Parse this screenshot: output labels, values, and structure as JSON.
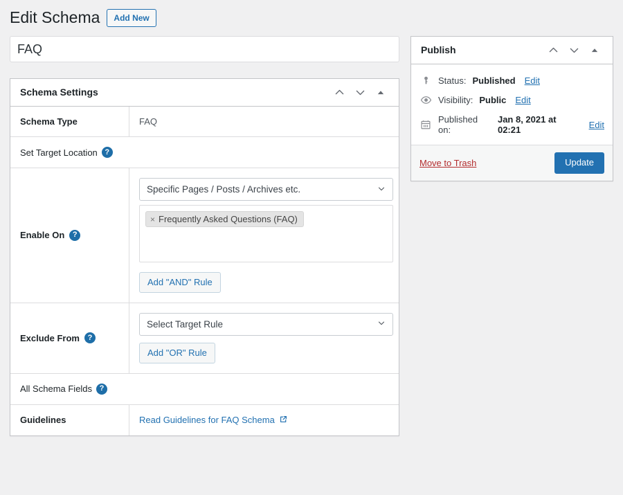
{
  "header": {
    "title": "Edit Schema",
    "add_new_label": "Add New"
  },
  "title_field": {
    "value": "FAQ",
    "placeholder": "Add title"
  },
  "schema_settings": {
    "panel_title": "Schema Settings",
    "schema_type_label": "Schema Type",
    "schema_type_value": "FAQ",
    "set_target_location_label": "Set Target Location",
    "help_glyph": "?",
    "enable_on": {
      "label": "Enable On",
      "select_value": "Specific Pages / Posts / Archives etc.",
      "tokens": [
        {
          "label": "Frequently Asked Questions (FAQ)",
          "remove_glyph": "×"
        }
      ],
      "add_rule_label": "Add \"AND\" Rule"
    },
    "exclude_from": {
      "label": "Exclude From",
      "select_value": "Select Target Rule",
      "add_rule_label": "Add \"OR\" Rule"
    },
    "all_schema_fields_label": "All Schema Fields",
    "guidelines_label": "Guidelines",
    "guidelines_link_text": "Read Guidelines for FAQ Schema"
  },
  "publish": {
    "panel_title": "Publish",
    "status_prefix": "Status:",
    "status_value": "Published",
    "status_edit": "Edit",
    "visibility_prefix": "Visibility:",
    "visibility_value": "Public",
    "visibility_edit": "Edit",
    "published_prefix": "Published on:",
    "published_value": "Jan 8, 2021 at 02:21",
    "published_edit": "Edit",
    "trash_label": "Move to Trash",
    "update_label": "Update"
  },
  "colors": {
    "accent": "#2271b1",
    "danger": "#b32d2e",
    "help_icon": "#1e6ea8",
    "page_bg": "#f0f0f1"
  }
}
